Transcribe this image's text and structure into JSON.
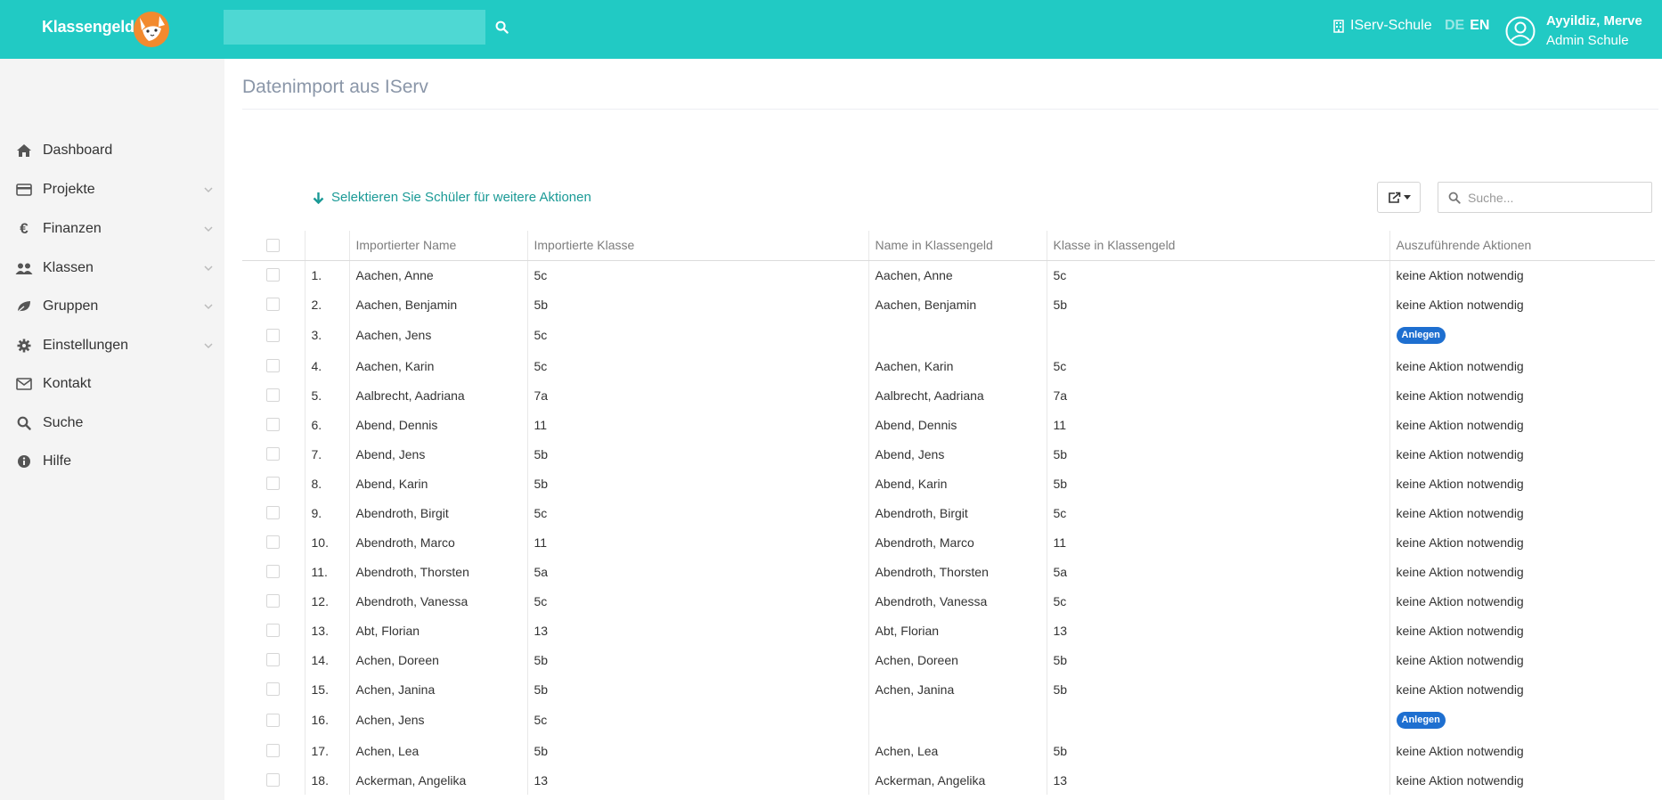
{
  "header": {
    "brand": "Klassengeld",
    "search_placeholder": "",
    "iserv_link": "IServ-Schule",
    "lang_de": "DE",
    "lang_en": "EN",
    "user_name": "Ayyildiz, Merve",
    "user_role": "Admin Schule",
    "colors": {
      "bar": "#21cac4",
      "logo": "#f28a2e"
    }
  },
  "sidebar": {
    "items": [
      {
        "label": "Dashboard",
        "icon": "home-icon",
        "expandable": false
      },
      {
        "label": "Projekte",
        "icon": "credit-card-icon",
        "expandable": true
      },
      {
        "label": "Finanzen",
        "icon": "euro-icon",
        "expandable": true
      },
      {
        "label": "Klassen",
        "icon": "users-icon",
        "expandable": true
      },
      {
        "label": "Gruppen",
        "icon": "leaf-icon",
        "expandable": true
      },
      {
        "label": "Einstellungen",
        "icon": "gear-icon",
        "expandable": true
      },
      {
        "label": "Kontakt",
        "icon": "envelope-icon",
        "expandable": false
      },
      {
        "label": "Suche",
        "icon": "search-icon",
        "expandable": false
      },
      {
        "label": "Hilfe",
        "icon": "info-icon",
        "expandable": false
      }
    ]
  },
  "main": {
    "title": "Datenimport aus IServ",
    "select_hint": "Selektieren Sie Schüler für weitere Aktionen",
    "table_search_placeholder": "Suche...",
    "columns": [
      "",
      "",
      "Importierter Name",
      "Importierte Klasse",
      "Name in Klassengeld",
      "Klasse in Klassengeld",
      "Auszuführende Aktionen"
    ],
    "rows": [
      {
        "num": "1.",
        "imp_name": "Aachen, Anne",
        "imp_class": "5c",
        "kg_name": "Aachen, Anne",
        "kg_class": "5c",
        "action": "keine Aktion notwendig",
        "badge": false
      },
      {
        "num": "2.",
        "imp_name": "Aachen, Benjamin",
        "imp_class": "5b",
        "kg_name": "Aachen, Benjamin",
        "kg_class": "5b",
        "action": "keine Aktion notwendig",
        "badge": false
      },
      {
        "num": "3.",
        "imp_name": "Aachen, Jens",
        "imp_class": "5c",
        "kg_name": "",
        "kg_class": "",
        "action": "Anlegen",
        "badge": true
      },
      {
        "num": "4.",
        "imp_name": "Aachen, Karin",
        "imp_class": "5c",
        "kg_name": "Aachen, Karin",
        "kg_class": "5c",
        "action": "keine Aktion notwendig",
        "badge": false
      },
      {
        "num": "5.",
        "imp_name": "Aalbrecht, Aadriana",
        "imp_class": "7a",
        "kg_name": "Aalbrecht, Aadriana",
        "kg_class": "7a",
        "action": "keine Aktion notwendig",
        "badge": false
      },
      {
        "num": "6.",
        "imp_name": "Abend, Dennis",
        "imp_class": "11",
        "kg_name": "Abend, Dennis",
        "kg_class": "11",
        "action": "keine Aktion notwendig",
        "badge": false
      },
      {
        "num": "7.",
        "imp_name": "Abend, Jens",
        "imp_class": "5b",
        "kg_name": "Abend, Jens",
        "kg_class": "5b",
        "action": "keine Aktion notwendig",
        "badge": false
      },
      {
        "num": "8.",
        "imp_name": "Abend, Karin",
        "imp_class": "5b",
        "kg_name": "Abend, Karin",
        "kg_class": "5b",
        "action": "keine Aktion notwendig",
        "badge": false
      },
      {
        "num": "9.",
        "imp_name": "Abendroth, Birgit",
        "imp_class": "5c",
        "kg_name": "Abendroth, Birgit",
        "kg_class": "5c",
        "action": "keine Aktion notwendig",
        "badge": false
      },
      {
        "num": "10.",
        "imp_name": "Abendroth, Marco",
        "imp_class": "11",
        "kg_name": "Abendroth, Marco",
        "kg_class": "11",
        "action": "keine Aktion notwendig",
        "badge": false
      },
      {
        "num": "11.",
        "imp_name": "Abendroth, Thorsten",
        "imp_class": "5a",
        "kg_name": "Abendroth, Thorsten",
        "kg_class": "5a",
        "action": "keine Aktion notwendig",
        "badge": false
      },
      {
        "num": "12.",
        "imp_name": "Abendroth, Vanessa",
        "imp_class": "5c",
        "kg_name": "Abendroth, Vanessa",
        "kg_class": "5c",
        "action": "keine Aktion notwendig",
        "badge": false
      },
      {
        "num": "13.",
        "imp_name": "Abt, Florian",
        "imp_class": "13",
        "kg_name": "Abt, Florian",
        "kg_class": "13",
        "action": "keine Aktion notwendig",
        "badge": false
      },
      {
        "num": "14.",
        "imp_name": "Achen, Doreen",
        "imp_class": "5b",
        "kg_name": "Achen, Doreen",
        "kg_class": "5b",
        "action": "keine Aktion notwendig",
        "badge": false
      },
      {
        "num": "15.",
        "imp_name": "Achen, Janina",
        "imp_class": "5b",
        "kg_name": "Achen, Janina",
        "kg_class": "5b",
        "action": "keine Aktion notwendig",
        "badge": false
      },
      {
        "num": "16.",
        "imp_name": "Achen, Jens",
        "imp_class": "5c",
        "kg_name": "",
        "kg_class": "",
        "action": "Anlegen",
        "badge": true
      },
      {
        "num": "17.",
        "imp_name": "Achen, Lea",
        "imp_class": "5b",
        "kg_name": "Achen, Lea",
        "kg_class": "5b",
        "action": "keine Aktion notwendig",
        "badge": false
      },
      {
        "num": "18.",
        "imp_name": "Ackerman, Angelika",
        "imp_class": "13",
        "kg_name": "Ackerman, Angelika",
        "kg_class": "13",
        "action": "keine Aktion notwendig",
        "badge": false
      }
    ]
  }
}
